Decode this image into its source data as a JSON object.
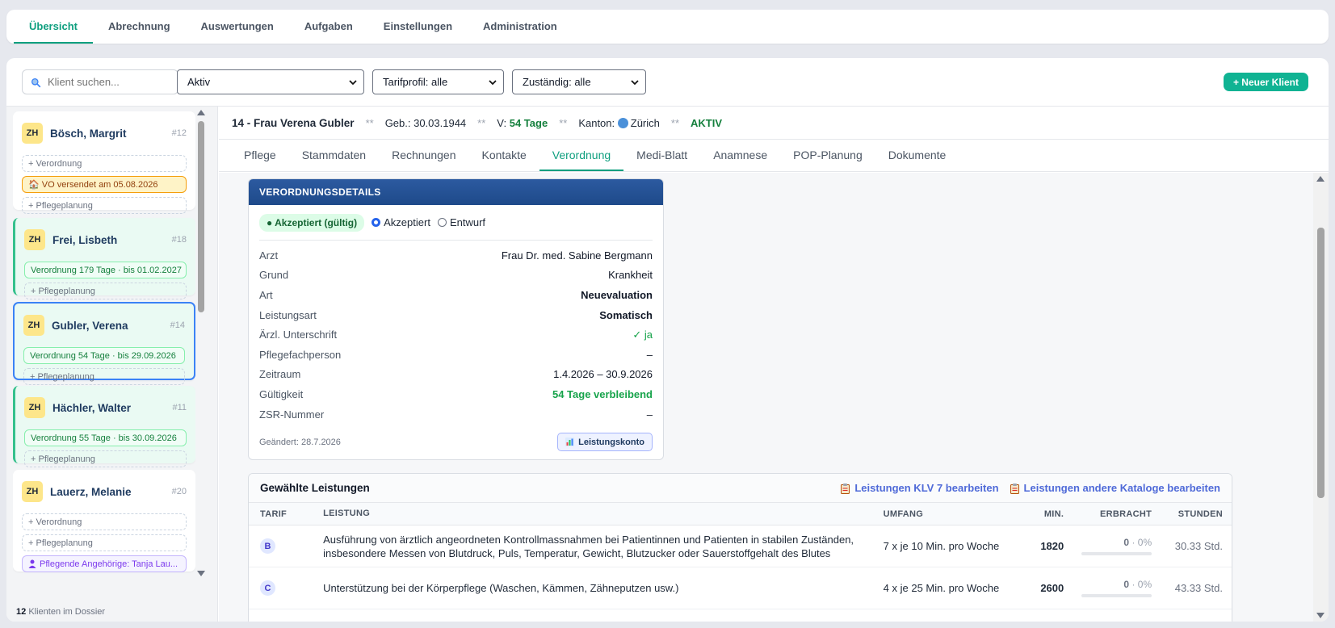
{
  "topnav": {
    "tabs": [
      {
        "label": "Übersicht",
        "active": true
      },
      {
        "label": "Abrechnung"
      },
      {
        "label": "Auswertungen"
      },
      {
        "label": "Aufgaben"
      },
      {
        "label": "Einstellungen"
      },
      {
        "label": "Administration"
      }
    ]
  },
  "filters": {
    "search_placeholder": "Klient suchen...",
    "status_value": "Aktiv",
    "tarif_value": "Tarifprofil: alle",
    "zustaendig_value": "Zuständig: alle",
    "new_client_label": "+ Neuer Klient"
  },
  "sidebar": {
    "clients": [
      {
        "kanton": "ZH",
        "name": "Bösch, Margrit",
        "id": "#12",
        "pills": [
          "+ Verordnung",
          "🏠 VO versendet am 05.08.2026",
          "+ Pflegeplanung"
        ]
      },
      {
        "kanton": "ZH",
        "name": "Frei, Lisbeth",
        "id": "#18",
        "pills": [
          "Verordnung 179 Tage · bis 01.02.2027",
          "+ Pflegeplanung"
        ]
      },
      {
        "kanton": "ZH",
        "name": "Gubler, Verena",
        "id": "#14",
        "pills": [
          "Verordnung 54 Tage · bis 29.09.2026",
          "+ Pflegeplanung"
        ]
      },
      {
        "kanton": "ZH",
        "name": "Hächler, Walter",
        "id": "#11",
        "pills": [
          "Verordnung 55 Tage · bis 30.09.2026",
          "+ Pflegeplanung"
        ]
      },
      {
        "kanton": "ZH",
        "name": "Lauerz, Melanie",
        "id": "#20",
        "pills": [
          "+ Verordnung",
          "+ Pflegeplanung",
          "Pflegende Angehörige: Tanja Lau..."
        ]
      }
    ],
    "footer_count": "12",
    "footer_text": "Klienten im Dossier"
  },
  "patient": {
    "title": "14 - Frau Verena Gubler",
    "sep": "**",
    "geb": "Geb.: 30.03.1944",
    "v_label": "V:",
    "v_value": "54 Tage",
    "kanton_label": "Kanton:",
    "kanton_value": "Zürich",
    "status": "AKTIV"
  },
  "subtabs": [
    {
      "label": "Pflege"
    },
    {
      "label": "Stammdaten"
    },
    {
      "label": "Rechnungen"
    },
    {
      "label": "Kontakte"
    },
    {
      "label": "Verordnung",
      "active": true
    },
    {
      "label": "Medi-Blatt"
    },
    {
      "label": "Anamnese"
    },
    {
      "label": "POP-Planung"
    },
    {
      "label": "Dokumente"
    }
  ],
  "verordnung": {
    "header": "VERORDNUNGSDETAILS",
    "badge": "● Akzeptiert (gültig)",
    "radio_accepted": "Akzeptiert",
    "radio_draft": "Entwurf",
    "rows": [
      {
        "key": "Arzt",
        "value": "Frau Dr. med. Sabine Bergmann"
      },
      {
        "key": "Grund",
        "value": "Krankheit"
      },
      {
        "key": "Art",
        "value": "Neuevaluation"
      },
      {
        "key": "Leistungsart",
        "value": "Somatisch"
      },
      {
        "key": "Ärzl. Unterschrift",
        "value": "✓ ja"
      },
      {
        "key": "Pflegefachperson",
        "value": "–"
      },
      {
        "key": "Zeitraum",
        "value": "1.4.2026 – 30.9.2026"
      },
      {
        "key": "Gültigkeit",
        "value": "54 Tage verbleibend"
      },
      {
        "key": "ZSR-Nummer",
        "value": "–"
      }
    ],
    "changed": "Geändert: 28.7.2026",
    "konto_label": "Leistungskonto"
  },
  "leistungen": {
    "title": "Gewählte Leistungen",
    "link_klv": "Leistungen KLV 7 bearbeiten",
    "link_other": "Leistungen andere Kataloge bearbeiten",
    "columns": [
      "TARIF",
      "LEISTUNG",
      "UMFANG",
      "MIN.",
      "ERBRACHT",
      "STUNDEN"
    ],
    "rows": [
      {
        "tarif": "B",
        "leistung": "Ausführung von ärztlich angeordneten Kontrollmassnahmen bei Patientinnen und Patienten in stabilen Zuständen, insbesondere Messen von Blutdruck, Puls, Temperatur, Gewicht, Blutzucker oder Sauerstoffgehalt des Blutes",
        "umfang": "7 x je 10 Min. pro Woche",
        "min": "1820",
        "erbracht": "0",
        "erbracht_pct": "· 0%",
        "erbracht_fraction": 0,
        "stunden": "30.33 Std."
      },
      {
        "tarif": "C",
        "leistung": "Unterstützung bei der Körperpflege (Waschen, Kämmen, Zähneputzen usw.)",
        "umfang": "4 x je 25 Min. pro Woche",
        "min": "2600",
        "erbracht": "0",
        "erbracht_pct": "· 0%",
        "erbracht_fraction": 0,
        "stunden": "43.33 Std."
      }
    ]
  }
}
